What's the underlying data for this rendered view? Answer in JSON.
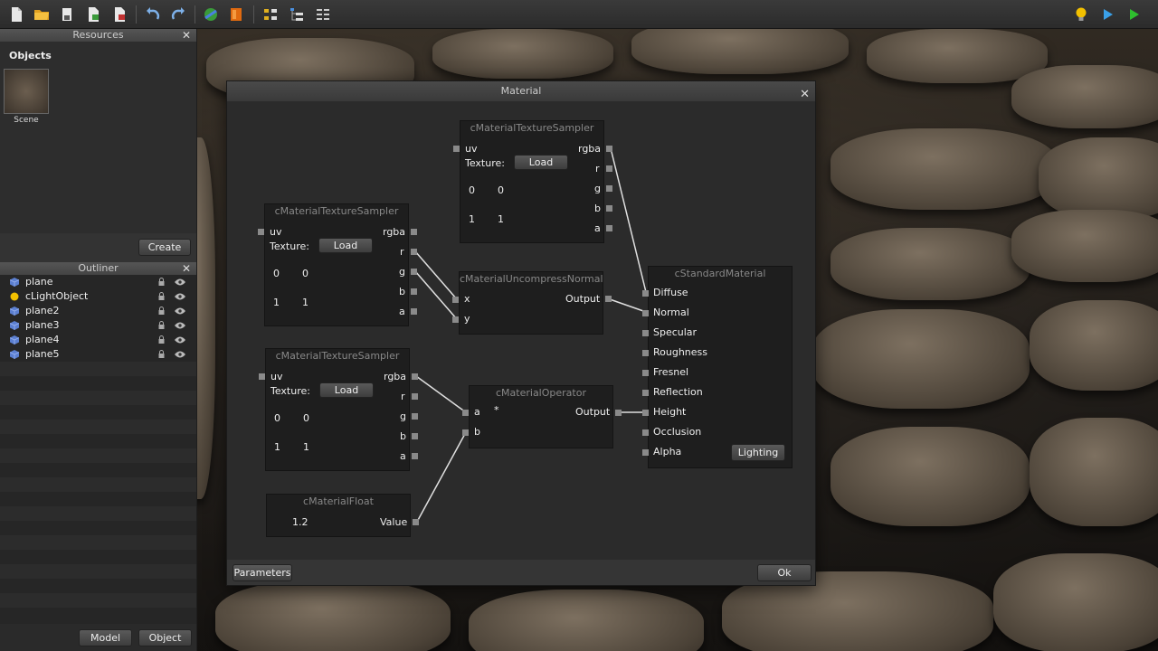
{
  "resources": {
    "title": "Resources",
    "objects_label": "Objects",
    "scene_label": "Scene",
    "create": "Create"
  },
  "outliner": {
    "title": "Outliner",
    "items": [
      {
        "label": "plane",
        "icon": "cube-icon",
        "color": "#5b7fd1"
      },
      {
        "label": "cLightObject",
        "icon": "light-icon",
        "color": "#f2c000"
      },
      {
        "label": "plane2",
        "icon": "cube-icon",
        "color": "#5b7fd1"
      },
      {
        "label": "plane3",
        "icon": "cube-icon",
        "color": "#5b7fd1"
      },
      {
        "label": "plane4",
        "icon": "cube-icon",
        "color": "#5b7fd1"
      },
      {
        "label": "plane5",
        "icon": "cube-icon",
        "color": "#5b7fd1"
      }
    ]
  },
  "footer": {
    "model": "Model",
    "object": "Object"
  },
  "material": {
    "title": "Material",
    "parameters": "Parameters",
    "ok": "Ok",
    "sampler1": {
      "title": "cMaterialTextureSampler",
      "uv": "uv",
      "texture": "Texture:",
      "load": "Load",
      "v00": "0",
      "v01": "0",
      "v10": "1",
      "v11": "1",
      "rgba": "rgba",
      "r": "r",
      "g": "g",
      "b": "b",
      "a": "a"
    },
    "sampler2": {
      "title": "cMaterialTextureSampler",
      "uv": "uv",
      "texture": "Texture:",
      "load": "Load",
      "v00": "0",
      "v01": "0",
      "v10": "1",
      "v11": "1",
      "rgba": "rgba",
      "r": "r",
      "g": "g",
      "b": "b",
      "a": "a"
    },
    "sampler3": {
      "title": "cMaterialTextureSampler",
      "uv": "uv",
      "texture": "Texture:",
      "load": "Load",
      "v00": "0",
      "v01": "0",
      "v10": "1",
      "v11": "1",
      "rgba": "rgba",
      "r": "r",
      "g": "g",
      "b": "b",
      "a": "a"
    },
    "uncompress": {
      "title": "cMaterialUncompressNormal",
      "x": "x",
      "y": "y",
      "output": "Output"
    },
    "operator": {
      "title": "cMaterialOperator",
      "a": "a",
      "b": "b",
      "op": "*",
      "output": "Output"
    },
    "float": {
      "title": "cMaterialFloat",
      "value": "1.2",
      "out": "Value"
    },
    "standard": {
      "title": "cStandardMaterial",
      "inputs": [
        "Diffuse",
        "Normal",
        "Specular",
        "Roughness",
        "Fresnel",
        "Reflection",
        "Height",
        "Occlusion",
        "Alpha"
      ],
      "lighting": "Lighting"
    }
  },
  "colors": {
    "play": "#3aa0e8",
    "run": "#2ec02e",
    "light": "#f2c000"
  }
}
